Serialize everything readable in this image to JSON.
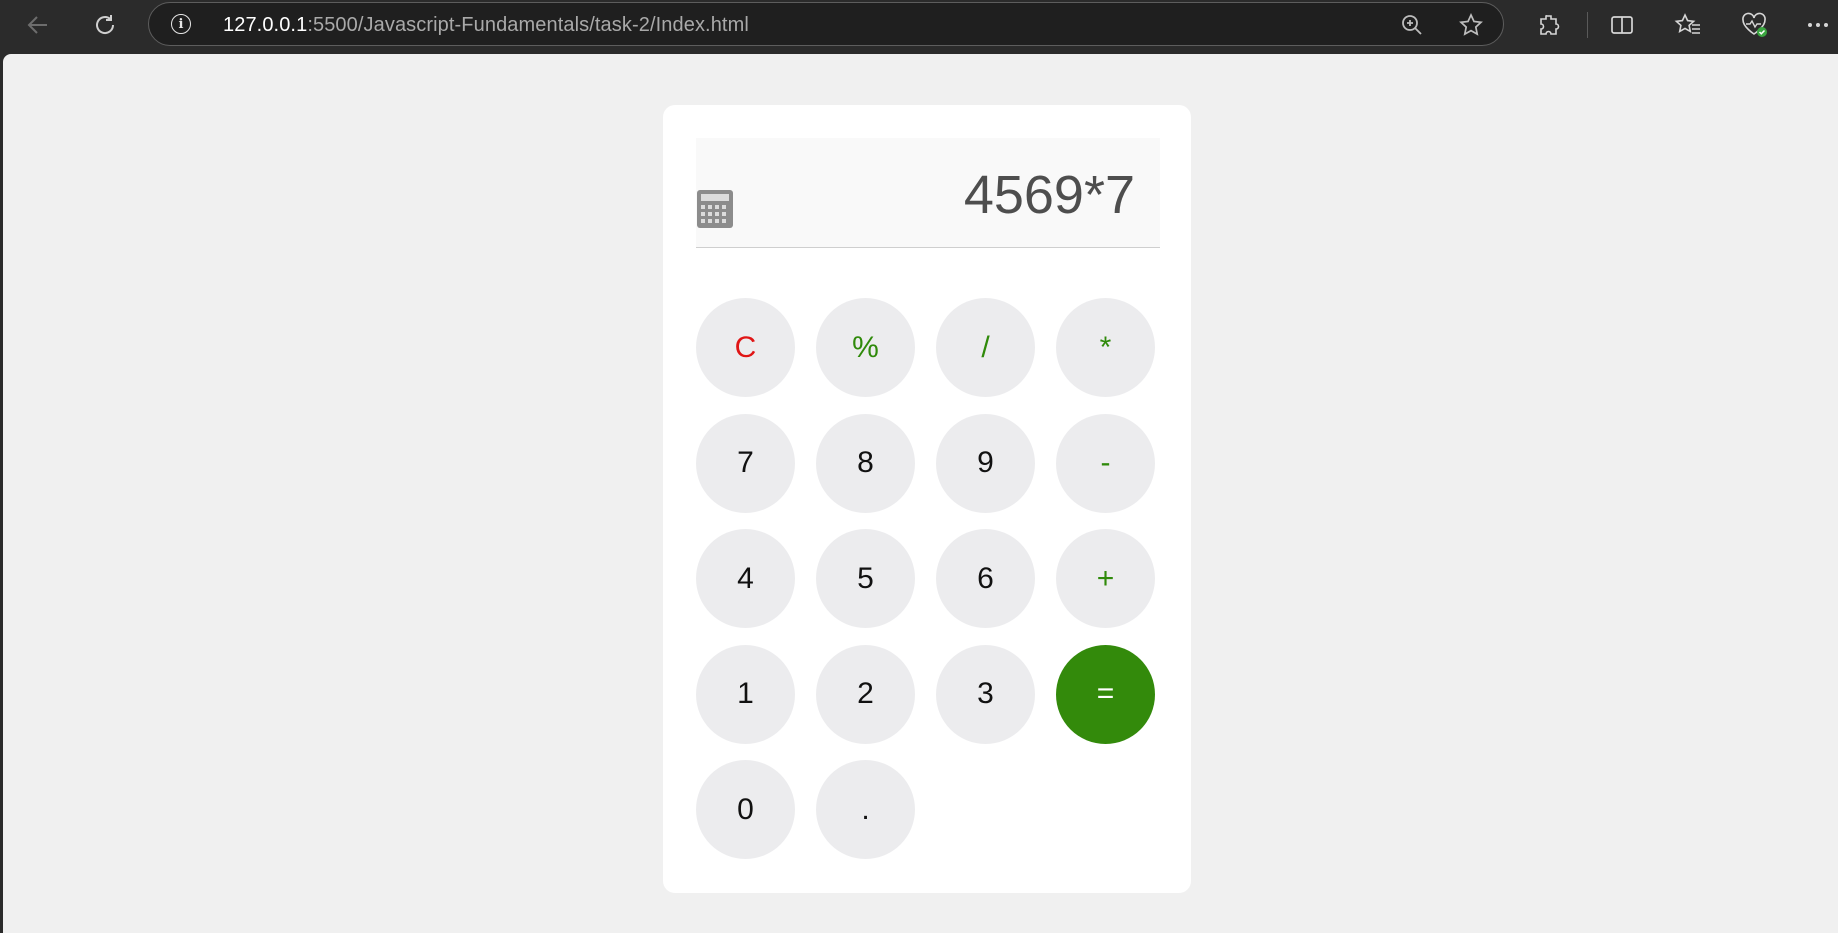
{
  "browser": {
    "url_host": "127.0.0.1",
    "url_rest": ":5500/Javascript-Fundamentals/task-2/Index.html"
  },
  "calculator": {
    "display": "4569*7",
    "keys": [
      {
        "label": "C",
        "name": "key-clear",
        "kind": "clear"
      },
      {
        "label": "%",
        "name": "key-percent",
        "kind": "op"
      },
      {
        "label": "/",
        "name": "key-divide",
        "kind": "op"
      },
      {
        "label": "*",
        "name": "key-multiply",
        "kind": "op"
      },
      {
        "label": "7",
        "name": "key-7",
        "kind": "digit"
      },
      {
        "label": "8",
        "name": "key-8",
        "kind": "digit"
      },
      {
        "label": "9",
        "name": "key-9",
        "kind": "digit"
      },
      {
        "label": "-",
        "name": "key-minus",
        "kind": "op"
      },
      {
        "label": "4",
        "name": "key-4",
        "kind": "digit"
      },
      {
        "label": "5",
        "name": "key-5",
        "kind": "digit"
      },
      {
        "label": "6",
        "name": "key-6",
        "kind": "digit"
      },
      {
        "label": "+",
        "name": "key-plus",
        "kind": "op"
      },
      {
        "label": "1",
        "name": "key-1",
        "kind": "digit"
      },
      {
        "label": "2",
        "name": "key-2",
        "kind": "digit"
      },
      {
        "label": "3",
        "name": "key-3",
        "kind": "digit"
      },
      {
        "label": "=",
        "name": "key-equals",
        "kind": "equals"
      },
      {
        "label": "0",
        "name": "key-0",
        "kind": "digit"
      },
      {
        "label": ".",
        "name": "key-decimal",
        "kind": "digit"
      }
    ]
  },
  "colors": {
    "operator": "#2f8a0a",
    "clear": "#e01515",
    "equals_bg": "#338a0b",
    "key_bg": "#ececee",
    "page_bg": "#f0f0f0"
  }
}
